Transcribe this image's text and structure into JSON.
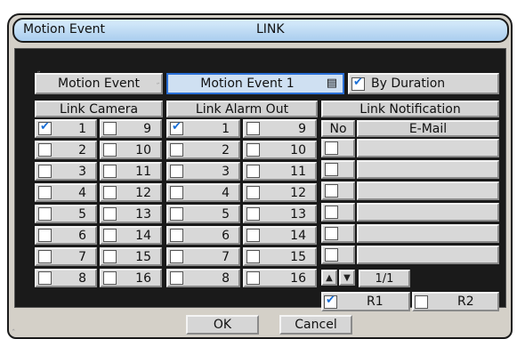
{
  "title": {
    "left": "Motion Event",
    "right": "LINK"
  },
  "top": {
    "event_label": "Motion Event",
    "event_value": "Motion Event 1",
    "by_duration": {
      "label": "By Duration",
      "checked": true
    }
  },
  "link_camera": {
    "header": "Link Camera",
    "items": [
      {
        "label": "1",
        "checked": true
      },
      {
        "label": "9",
        "checked": false
      },
      {
        "label": "2",
        "checked": false
      },
      {
        "label": "10",
        "checked": false
      },
      {
        "label": "3",
        "checked": false
      },
      {
        "label": "11",
        "checked": false
      },
      {
        "label": "4",
        "checked": false
      },
      {
        "label": "12",
        "checked": false
      },
      {
        "label": "5",
        "checked": false
      },
      {
        "label": "13",
        "checked": false
      },
      {
        "label": "6",
        "checked": false
      },
      {
        "label": "14",
        "checked": false
      },
      {
        "label": "7",
        "checked": false
      },
      {
        "label": "15",
        "checked": false
      },
      {
        "label": "8",
        "checked": false
      },
      {
        "label": "16",
        "checked": false
      }
    ]
  },
  "link_alarm_out": {
    "header": "Link Alarm Out",
    "items": [
      {
        "label": "1",
        "checked": true
      },
      {
        "label": "9",
        "checked": false
      },
      {
        "label": "2",
        "checked": false
      },
      {
        "label": "10",
        "checked": false
      },
      {
        "label": "3",
        "checked": false
      },
      {
        "label": "11",
        "checked": false
      },
      {
        "label": "4",
        "checked": false
      },
      {
        "label": "12",
        "checked": false
      },
      {
        "label": "5",
        "checked": false
      },
      {
        "label": "13",
        "checked": false
      },
      {
        "label": "6",
        "checked": false
      },
      {
        "label": "14",
        "checked": false
      },
      {
        "label": "7",
        "checked": false
      },
      {
        "label": "15",
        "checked": false
      },
      {
        "label": "8",
        "checked": false
      },
      {
        "label": "16",
        "checked": false
      }
    ]
  },
  "link_notification": {
    "header": "Link Notification",
    "col_no": "No",
    "col_email": "E-Mail",
    "rows": [
      {
        "checked": false,
        "email": ""
      },
      {
        "checked": false,
        "email": ""
      },
      {
        "checked": false,
        "email": ""
      },
      {
        "checked": false,
        "email": ""
      },
      {
        "checked": false,
        "email": ""
      },
      {
        "checked": false,
        "email": ""
      }
    ],
    "page": "1/1",
    "r1": {
      "label": "R1",
      "checked": true
    },
    "r2": {
      "label": "R2",
      "checked": false
    }
  },
  "buttons": {
    "ok": "OK",
    "cancel": "Cancel"
  },
  "icons": {
    "dropdown": "dropdown-icon",
    "up": "arrow-up-icon",
    "down": "arrow-down-icon"
  }
}
